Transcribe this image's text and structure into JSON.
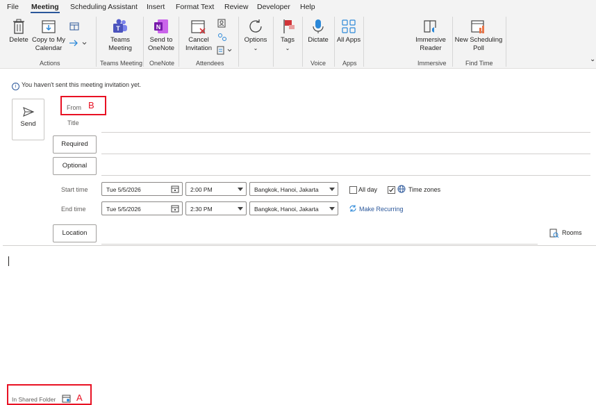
{
  "menu": {
    "items": [
      "File",
      "Meeting",
      "Scheduling Assistant",
      "Insert",
      "Format Text",
      "Review",
      "Developer",
      "Help"
    ],
    "active": "Meeting"
  },
  "ribbon": {
    "delete": "Delete",
    "copy_to_my_calendar": "Copy to My Calendar",
    "actions_group": "Actions",
    "teams_meeting": "Teams Meeting",
    "teams_group": "Teams Meeting",
    "send_to_onenote": "Send to OneNote",
    "onenote_group": "OneNote",
    "cancel_invitation": "Cancel Invitation",
    "attendees_group": "Attendees",
    "options": "Options",
    "tags": "Tags",
    "dictate": "Dictate",
    "voice_group": "Voice",
    "all_apps": "All Apps",
    "apps_group": "Apps",
    "immersive_reader": "Immersive Reader",
    "immersive_group": "Immersive",
    "new_scheduling_poll": "New Scheduling Poll",
    "find_time_group": "Find Time"
  },
  "form": {
    "notice": "You haven't sent this meeting invitation yet.",
    "send": "Send",
    "from_label": "From",
    "title_label": "Title",
    "required": "Required",
    "optional": "Optional",
    "start_time_label": "Start time",
    "end_time_label": "End time",
    "start_date": "Tue 5/5/2026",
    "start_time": "2:00 PM",
    "start_tz": "Bangkok, Hanoi, Jakarta",
    "end_date": "Tue 5/5/2026",
    "end_time": "2:30 PM",
    "end_tz": "Bangkok, Hanoi, Jakarta",
    "all_day": "All day",
    "time_zones": "Time zones",
    "time_zones_checked": true,
    "make_recurring": "Make Recurring",
    "location": "Location",
    "rooms": "Rooms"
  },
  "footer": {
    "in_shared_folder": "In Shared Folder"
  },
  "annotations": {
    "marker_b": "B",
    "marker_a": "A",
    "color": "#e81123"
  }
}
